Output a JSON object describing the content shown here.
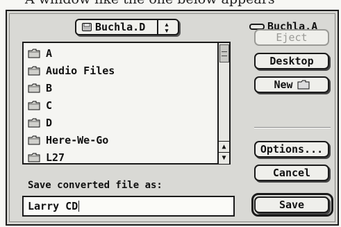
{
  "caption": "A window like the one below appears",
  "popup": {
    "label": "Buchla.D"
  },
  "volume": {
    "label": "Buchla.A"
  },
  "files": [
    "A",
    "Audio Files",
    "B",
    "C",
    "D",
    "Here-We-Go",
    "L27"
  ],
  "buttons": {
    "eject": "Eject",
    "desktop": "Desktop",
    "new": "New",
    "options": "Options...",
    "cancel": "Cancel",
    "save": "Save"
  },
  "save_prompt": "Save converted file as:",
  "filename": "Larry CD"
}
